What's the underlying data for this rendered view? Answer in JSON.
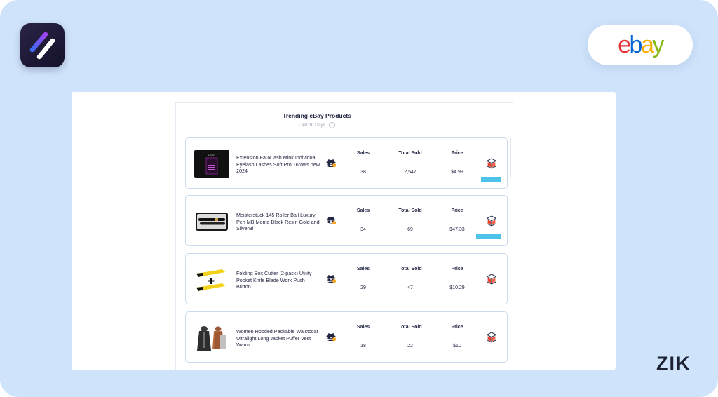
{
  "branding": {
    "app_logo_icon": "zik-app-logo-icon",
    "marketplace_logo_letters": [
      {
        "char": "e",
        "color": "#e53238"
      },
      {
        "char": "b",
        "color": "#0064d2"
      },
      {
        "char": "a",
        "color": "#f5af02"
      },
      {
        "char": "y",
        "color": "#86b817"
      }
    ],
    "watermark": "ZIK"
  },
  "panel": {
    "title": "Trending eBay Products",
    "subtitle": "Last 30 Days",
    "help_glyph": "?"
  },
  "columns": {
    "sales": "Sales",
    "total_sold": "Total Sold",
    "price": "Price"
  },
  "products": [
    {
      "name": "Extension Faux lash Mink Individual Eyelash Lashes Soft Pro 16rows new 2024",
      "sales": "38",
      "total_sold": "2,547",
      "price": "$4.99",
      "thumbnail": "eyelash-box-image",
      "spy_icon": "spy-icon",
      "action_icon": "box-icon",
      "highlight_bar": true
    },
    {
      "name": "Meisterstuck 145 Roller Ball Luxury Pen MB Monte Black Resin Gold and SilverBl",
      "sales": "34",
      "total_sold": "69",
      "price": "$47.33",
      "thumbnail": "pen-case-image",
      "spy_icon": "spy-icon",
      "action_icon": "box-icon",
      "highlight_bar": true
    },
    {
      "name": "Folding Box Cutter (2-pack) Utility Pocket Knife Blade Work Push Button",
      "sales": "29",
      "total_sold": "47",
      "price": "$10.29",
      "thumbnail": "box-cutter-image",
      "spy_icon": "spy-icon",
      "action_icon": "box-icon",
      "highlight_bar": false
    },
    {
      "name": "Women Hooded Packable Waistcoat Ultralight Long Jacket Puffer Vest Warm",
      "sales": "18",
      "total_sold": "22",
      "price": "$10",
      "thumbnail": "puffer-vest-image",
      "spy_icon": "spy-icon",
      "action_icon": "box-icon",
      "highlight_bar": false
    }
  ],
  "colors": {
    "background": "#cfe3fb",
    "accent_bar": "#4ec3ea",
    "card_border": "#c9dcef",
    "text": "#1f2340"
  }
}
